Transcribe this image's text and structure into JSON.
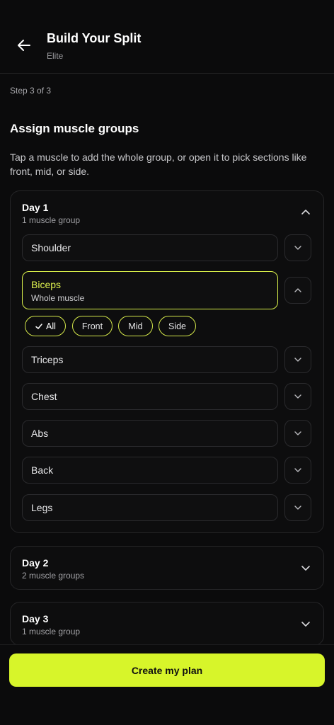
{
  "header": {
    "title": "Build Your Split",
    "subtitle": "Elite"
  },
  "step_label": "Step 3 of 3",
  "section_title": "Assign muscle groups",
  "description": "Tap a muscle to add the whole group, or open it to pick sections like front, mid, or side.",
  "days": [
    {
      "title": "Day 1",
      "subtitle": "1 muscle group",
      "expanded": true,
      "muscles": [
        {
          "name": "Shoulder"
        },
        {
          "name": "Biceps",
          "selection": "Whole muscle",
          "selected": true
        },
        {
          "name": "Triceps"
        },
        {
          "name": "Chest"
        },
        {
          "name": "Abs"
        },
        {
          "name": "Back"
        },
        {
          "name": "Legs"
        }
      ],
      "sections": [
        {
          "label": "All",
          "selected": true
        },
        {
          "label": "Front"
        },
        {
          "label": "Mid"
        },
        {
          "label": "Side"
        }
      ]
    },
    {
      "title": "Day 2",
      "subtitle": "2 muscle groups",
      "expanded": false
    },
    {
      "title": "Day 3",
      "subtitle": "1 muscle group",
      "expanded": false
    }
  ],
  "cta_label": "Create my plan",
  "colors": {
    "accent": "#d7f52a",
    "background": "#0b0b0c"
  },
  "icons": {
    "back": "arrow-left-icon",
    "expand": "chevron-down-icon",
    "collapse": "chevron-up-icon",
    "check": "check-icon"
  }
}
